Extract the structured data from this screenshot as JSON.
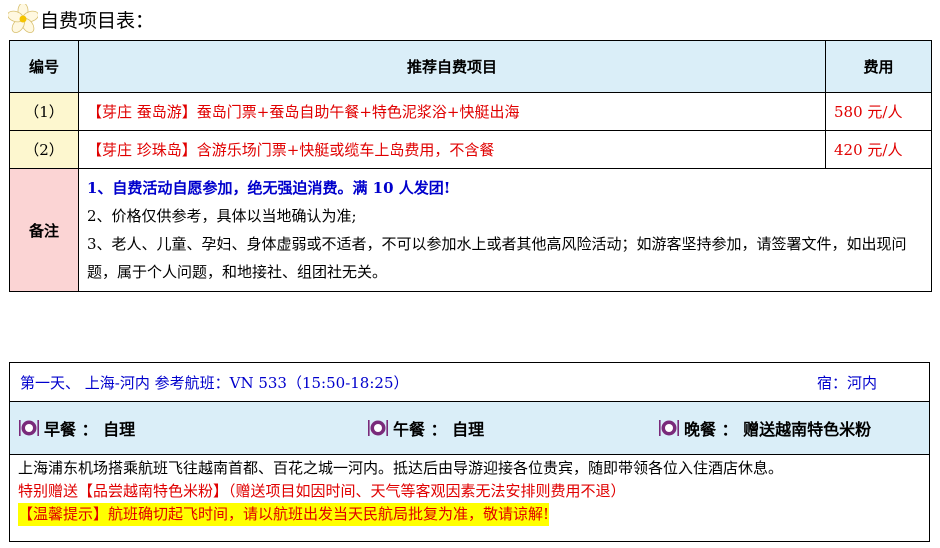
{
  "title": "自费项目表：",
  "table": {
    "headers": [
      "编号",
      "推荐自费项目",
      "费用"
    ],
    "rows": [
      {
        "num": "（1）",
        "item": "【芽庄 蚕岛游】蚕岛门票+蚕岛自助午餐+特色泥浆浴+快艇出海",
        "fee": "580 元/人"
      },
      {
        "num": "（2）",
        "item": "【芽庄 珍珠岛】含游乐场门票+快艇或缆车上岛费用，不含餐",
        "fee": "420 元/人"
      }
    ],
    "note_label": "备注",
    "notes": [
      "1、自费活动自愿参加，绝无强迫消费。满 10 人发团!",
      "2、价格仅供参考，具体以当地确认为准;",
      "3、老人、儿童、孕妇、身体虚弱或不适者，不可以参加水上或者其他高风险活动；如游客坚持参加，请签署文件，如出现问题，属于个人问题，和地接社、组团社无关。"
    ]
  },
  "day": {
    "heading": "第一天、 上海-河内  参考航班：VN 533（15:50-18:25）",
    "stay": "宿：河内",
    "meals": {
      "breakfast": "早餐 ： 自理",
      "lunch": "午餐 ： 自理",
      "dinner": "晚餐 ： 赠送越南特色米粉"
    },
    "description": "上海浦东机场搭乘航班飞往越南首都、百花之城一河内。抵达后由导游迎接各位贵宾，随即带领各位入住酒店休息。",
    "gift": "特别赠送【品尝越南特色米粉】（赠送项目如因时间、天气等客观因素无法安排则费用不退）",
    "tip": "【温馨提示】航班确切起飞时间，请以航班出发当天民航局批复为准，敬请谅解!"
  }
}
